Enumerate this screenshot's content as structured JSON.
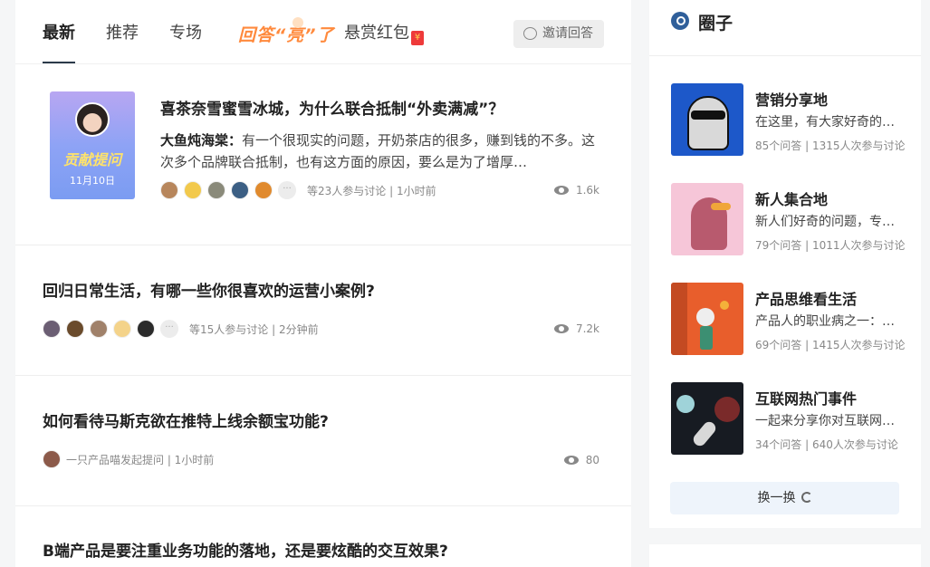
{
  "tabs": {
    "latest": "最新",
    "recommend": "推荐",
    "special": "专场",
    "promo": "回答“亮”了",
    "bounty": "悬赏红包",
    "bounty_badge": "¥",
    "invite": "邀请回答"
  },
  "feed": [
    {
      "title": "喜茶奈雪蜜雪冰城，为什么联合抵制“外卖满减”？",
      "cover_title": "贡献提问",
      "cover_date": "11月10日",
      "author": "大鱼炖海棠：",
      "excerpt": "有一个很现实的问题，开奶茶店的很多，赚到钱的不多。这次多个品牌联合抵制，也有这方面的原因，要么是为了增厚…",
      "meta": "等23人参与讨论 | 1小时前",
      "views": "1.6k",
      "more": "···"
    },
    {
      "title": "回归日常生活，有哪一些你很喜欢的运营小案例?",
      "meta": "等15人参与讨论 | 2分钟前",
      "views": "7.2k",
      "more": "···"
    },
    {
      "title": "如何看待马斯克欲在推特上线余额宝功能?",
      "meta": "一只产品喵发起提问 | 1小时前",
      "views": "80"
    },
    {
      "title": "B端产品是要注重业务功能的落地，还是要炫酷的交互效果?"
    }
  ],
  "sidebar": {
    "title": "圈子",
    "groups": [
      {
        "name": "营销分享地",
        "desc": "在这里，有大家好奇的营销干货",
        "stats": "85个问答 | 1315人次参与讨论"
      },
      {
        "name": "新人集合地",
        "desc": "新人们好奇的问题，专家来解答",
        "stats": "79个问答 | 1011人次参与讨论"
      },
      {
        "name": "产品思维看生活",
        "desc": "产品人的职业病之一：用产品思维看生活",
        "stats": "69个问答 | 1415人次参与讨论"
      },
      {
        "name": "互联网热门事件",
        "desc": "一起来分享你对互联网热门事件的看法",
        "stats": "34个问答 | 640人次参与讨论"
      }
    ],
    "refresh": "换一换"
  },
  "colors": {
    "promo": "#ff8a3d",
    "accent_dark": "#2b3a4a",
    "refresh_bg": "#eef4fb"
  }
}
